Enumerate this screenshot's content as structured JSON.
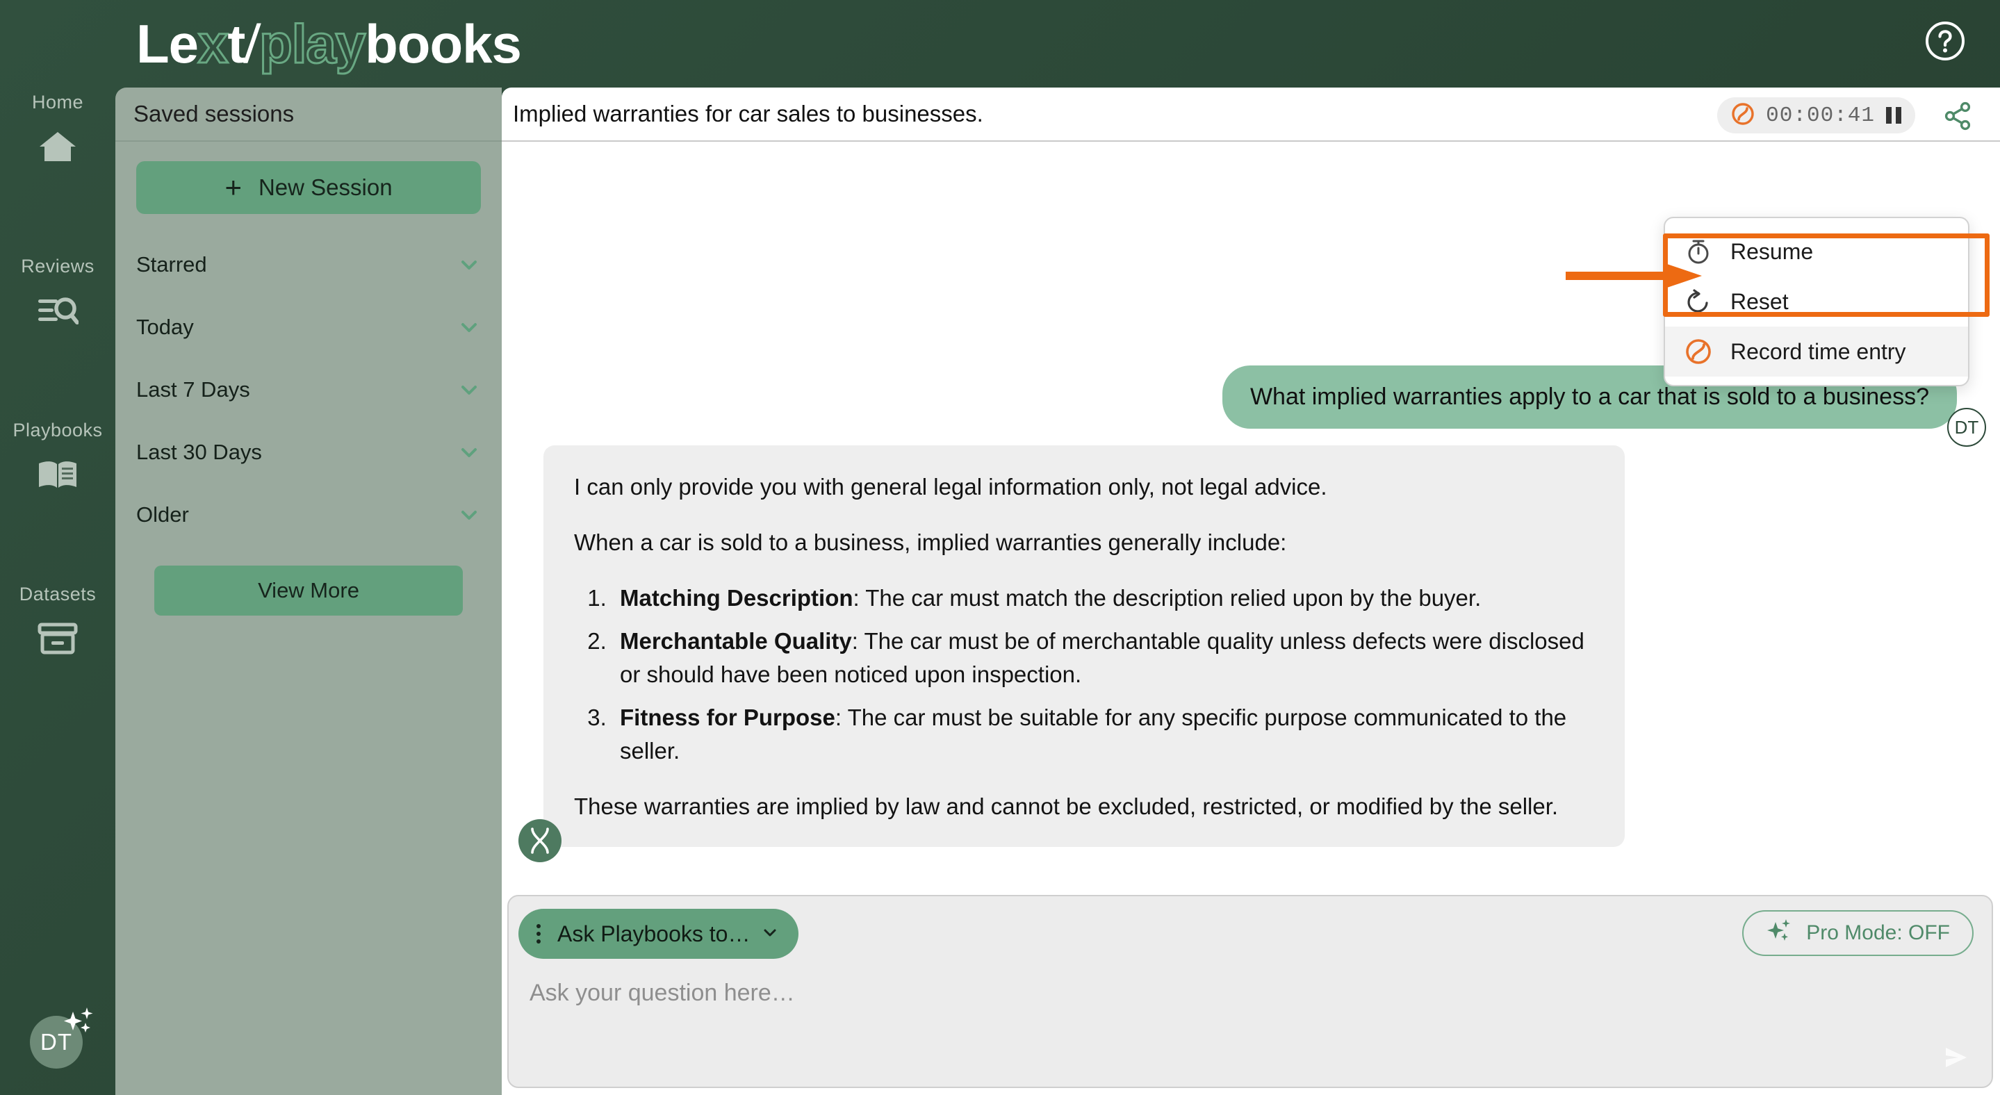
{
  "brand": {
    "logo_part1": "Le",
    "logo_part2": "x",
    "logo_part3": "t",
    "logo_slash": "/",
    "logo_part4": "play",
    "logo_part5": "books",
    "accent_green": "#63a07d",
    "dark_green": "#2d4a3a",
    "annotation_orange": "#ed6a12"
  },
  "topbar": {
    "help_icon": "help-circle-icon"
  },
  "rail": {
    "items": [
      {
        "label": "Home",
        "icon": "home-icon"
      },
      {
        "label": "Reviews",
        "icon": "search-list-icon"
      },
      {
        "label": "Playbooks",
        "icon": "open-book-icon"
      },
      {
        "label": "Datasets",
        "icon": "archive-box-icon"
      }
    ],
    "avatar_initials": "DT",
    "avatar_sparkle_icon": "sparkles-icon"
  },
  "sessions": {
    "header": "Saved sessions",
    "new_session_label": "New Session",
    "new_session_icon": "plus-icon",
    "categories": [
      {
        "label": "Starred",
        "icon": "chevron-down-icon"
      },
      {
        "label": "Today",
        "icon": "chevron-down-icon"
      },
      {
        "label": "Last 7 Days",
        "icon": "chevron-down-icon"
      },
      {
        "label": "Last 30 Days",
        "icon": "chevron-down-icon"
      },
      {
        "label": "Older",
        "icon": "chevron-down-icon"
      }
    ],
    "view_more_label": "View More"
  },
  "main": {
    "title": "Implied warranties for car sales to businesses.",
    "timer": {
      "value": "00:00:41",
      "brand_icon": "lext-swirl-icon",
      "state_icon": "pause-icon"
    },
    "share_icon": "share-icon"
  },
  "timer_menu": {
    "items": [
      {
        "label": "Resume",
        "icon": "stopwatch-icon",
        "active": false
      },
      {
        "label": "Reset",
        "icon": "reset-arrow-icon",
        "active": false
      },
      {
        "label": "Record time entry",
        "icon": "lext-swirl-icon",
        "active": true
      }
    ]
  },
  "annotation": {
    "target_label": "Record time entry",
    "shape": "rectangle-with-arrow",
    "color": "#ed6a12"
  },
  "chat": {
    "user_message": "What implied warranties apply to a car that is sold to a business?",
    "user_avatar_initials": "DT",
    "bot_avatar_icon": "lext-x-icon",
    "bot_paragraph_1": "I can only provide you with general legal information only, not legal advice.",
    "bot_paragraph_2": "When a car is sold to a business, implied warranties generally include:",
    "bot_list": [
      {
        "term": "Matching Description",
        "text": ": The car must match the description relied upon by the buyer."
      },
      {
        "term": "Merchantable Quality",
        "text": ": The car must be of merchantable quality unless defects were disclosed or should have been noticed upon inspection."
      },
      {
        "term": "Fitness for Purpose",
        "text": ": The car must be suitable for any specific purpose communicated to the seller."
      }
    ],
    "bot_paragraph_3": "These warranties are implied by law and cannot be excluded, restricted, or modified by the seller."
  },
  "composer": {
    "ask_label": "Ask Playbooks to…",
    "ask_menu_icon": "vertical-dots-icon",
    "ask_chevron_icon": "chevron-down-icon",
    "pro_mode_label": "Pro Mode: OFF",
    "pro_mode_icon": "sparkles-icon",
    "placeholder": "Ask your question here…",
    "send_icon": "send-arrow-icon"
  }
}
